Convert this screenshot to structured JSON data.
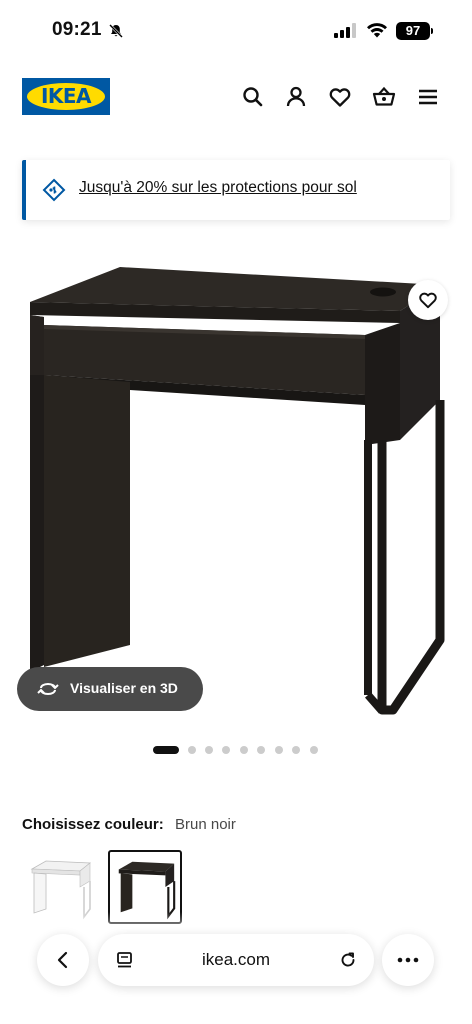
{
  "status_bar": {
    "time": "09:21",
    "battery": "97"
  },
  "header": {
    "logo": "IKEA",
    "icons": [
      "search-icon",
      "user-icon",
      "heart-icon",
      "basket-icon",
      "menu-icon"
    ]
  },
  "promo": {
    "text": "Jusqu'à 20% sur les protections pour sol",
    "icon": "price-tag-icon"
  },
  "product": {
    "view_3d_label": "Visualiser en 3D",
    "image_count": 9,
    "active_image": 1
  },
  "color": {
    "label": "Choisissez couleur:",
    "value": "Brun noir",
    "options_selected": 2
  },
  "browser": {
    "url": "ikea.com"
  },
  "colors": {
    "ikea_blue": "#0058a3",
    "ikea_yellow": "#ffdb00",
    "desk_dark": "#2b2723"
  }
}
